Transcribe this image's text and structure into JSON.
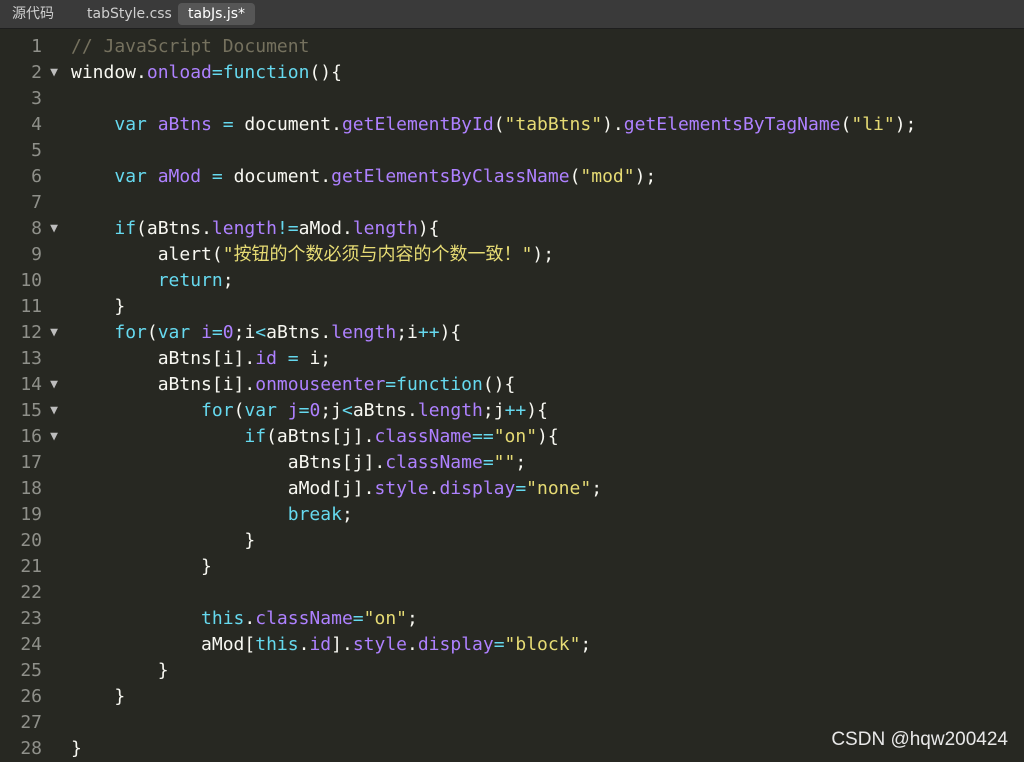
{
  "tabs": [
    {
      "label": "源代码",
      "active": false
    },
    {
      "label": "tabStyle.css",
      "active": false
    },
    {
      "label": "tabJs.js*",
      "active": true
    }
  ],
  "colors": {
    "background": "#272822",
    "comment": "#75715e",
    "keyword": "#66d9ef",
    "property": "#ae81ff",
    "string": "#e6db74",
    "number": "#ae81ff",
    "text": "#f8f8f2"
  },
  "fold_icon": "triangle-down-icon",
  "editor": {
    "lines": [
      {
        "num": "1",
        "fold": false,
        "tokens": [
          [
            "comment",
            "// JavaScript Document"
          ]
        ]
      },
      {
        "num": "2",
        "fold": true,
        "tokens": [
          [
            "plain",
            "window."
          ],
          [
            "property",
            "onload"
          ],
          [
            "keyword",
            "=function"
          ],
          [
            "plain",
            "(){"
          ]
        ]
      },
      {
        "num": "3",
        "fold": false,
        "tokens": []
      },
      {
        "num": "4",
        "fold": false,
        "tokens": [
          [
            "plain",
            "    "
          ],
          [
            "keyword",
            "var"
          ],
          [
            "plain",
            " "
          ],
          [
            "property",
            "aBtns"
          ],
          [
            "plain",
            " "
          ],
          [
            "keyword",
            "="
          ],
          [
            "plain",
            " document."
          ],
          [
            "property",
            "getElementById"
          ],
          [
            "plain",
            "("
          ],
          [
            "string",
            "\"tabBtns\""
          ],
          [
            "plain",
            ")."
          ],
          [
            "property",
            "getElementsByTagName"
          ],
          [
            "plain",
            "("
          ],
          [
            "string",
            "\"li\""
          ],
          [
            "plain",
            ");"
          ]
        ]
      },
      {
        "num": "5",
        "fold": false,
        "tokens": []
      },
      {
        "num": "6",
        "fold": false,
        "tokens": [
          [
            "plain",
            "    "
          ],
          [
            "keyword",
            "var"
          ],
          [
            "plain",
            " "
          ],
          [
            "property",
            "aMod"
          ],
          [
            "plain",
            " "
          ],
          [
            "keyword",
            "="
          ],
          [
            "plain",
            " document."
          ],
          [
            "property",
            "getElementsByClassName"
          ],
          [
            "plain",
            "("
          ],
          [
            "string",
            "\"mod\""
          ],
          [
            "plain",
            ");"
          ]
        ]
      },
      {
        "num": "7",
        "fold": false,
        "tokens": []
      },
      {
        "num": "8",
        "fold": true,
        "tokens": [
          [
            "plain",
            "    "
          ],
          [
            "keyword",
            "if"
          ],
          [
            "plain",
            "(aBtns."
          ],
          [
            "property",
            "length"
          ],
          [
            "keyword",
            "!="
          ],
          [
            "plain",
            "aMod."
          ],
          [
            "property",
            "length"
          ],
          [
            "plain",
            "){"
          ]
        ]
      },
      {
        "num": "9",
        "fold": false,
        "tokens": [
          [
            "plain",
            "        alert("
          ],
          [
            "string",
            "\""
          ],
          [
            "cjk",
            "按钮的个数必须与内容的个数一致！"
          ],
          [
            "string",
            "\""
          ],
          [
            "plain",
            ");"
          ]
        ]
      },
      {
        "num": "10",
        "fold": false,
        "tokens": [
          [
            "plain",
            "        "
          ],
          [
            "keyword",
            "return"
          ],
          [
            "plain",
            ";"
          ]
        ]
      },
      {
        "num": "11",
        "fold": false,
        "tokens": [
          [
            "plain",
            "    }"
          ]
        ]
      },
      {
        "num": "12",
        "fold": true,
        "tokens": [
          [
            "plain",
            "    "
          ],
          [
            "keyword",
            "for"
          ],
          [
            "plain",
            "("
          ],
          [
            "keyword",
            "var"
          ],
          [
            "plain",
            " "
          ],
          [
            "property",
            "i"
          ],
          [
            "keyword",
            "="
          ],
          [
            "number",
            "0"
          ],
          [
            "plain",
            ";i"
          ],
          [
            "keyword",
            "<"
          ],
          [
            "plain",
            "aBtns."
          ],
          [
            "property",
            "length"
          ],
          [
            "plain",
            ";i"
          ],
          [
            "keyword",
            "++"
          ],
          [
            "plain",
            "){"
          ]
        ]
      },
      {
        "num": "13",
        "fold": false,
        "tokens": [
          [
            "plain",
            "        aBtns[i]."
          ],
          [
            "property",
            "id"
          ],
          [
            "plain",
            " "
          ],
          [
            "keyword",
            "="
          ],
          [
            "plain",
            " i;"
          ]
        ]
      },
      {
        "num": "14",
        "fold": true,
        "tokens": [
          [
            "plain",
            "        aBtns[i]."
          ],
          [
            "property",
            "onmouseenter"
          ],
          [
            "keyword",
            "=function"
          ],
          [
            "plain",
            "(){"
          ]
        ]
      },
      {
        "num": "15",
        "fold": true,
        "tokens": [
          [
            "plain",
            "            "
          ],
          [
            "keyword",
            "for"
          ],
          [
            "plain",
            "("
          ],
          [
            "keyword",
            "var"
          ],
          [
            "plain",
            " "
          ],
          [
            "property",
            "j"
          ],
          [
            "keyword",
            "="
          ],
          [
            "number",
            "0"
          ],
          [
            "plain",
            ";j"
          ],
          [
            "keyword",
            "<"
          ],
          [
            "plain",
            "aBtns."
          ],
          [
            "property",
            "length"
          ],
          [
            "plain",
            ";j"
          ],
          [
            "keyword",
            "++"
          ],
          [
            "plain",
            "){"
          ]
        ]
      },
      {
        "num": "16",
        "fold": true,
        "tokens": [
          [
            "plain",
            "                "
          ],
          [
            "keyword",
            "if"
          ],
          [
            "plain",
            "(aBtns[j]."
          ],
          [
            "property",
            "className"
          ],
          [
            "keyword",
            "=="
          ],
          [
            "string",
            "\"on\""
          ],
          [
            "plain",
            "){"
          ]
        ]
      },
      {
        "num": "17",
        "fold": false,
        "tokens": [
          [
            "plain",
            "                    aBtns[j]."
          ],
          [
            "property",
            "className"
          ],
          [
            "keyword",
            "="
          ],
          [
            "string",
            "\"\""
          ],
          [
            "plain",
            ";"
          ]
        ]
      },
      {
        "num": "18",
        "fold": false,
        "tokens": [
          [
            "plain",
            "                    aMod[j]."
          ],
          [
            "property",
            "style"
          ],
          [
            "plain",
            "."
          ],
          [
            "property",
            "display"
          ],
          [
            "keyword",
            "="
          ],
          [
            "string",
            "\"none\""
          ],
          [
            "plain",
            ";"
          ]
        ]
      },
      {
        "num": "19",
        "fold": false,
        "tokens": [
          [
            "plain",
            "                    "
          ],
          [
            "keyword",
            "break"
          ],
          [
            "plain",
            ";"
          ]
        ]
      },
      {
        "num": "20",
        "fold": false,
        "tokens": [
          [
            "plain",
            "                }"
          ]
        ]
      },
      {
        "num": "21",
        "fold": false,
        "tokens": [
          [
            "plain",
            "            }"
          ]
        ]
      },
      {
        "num": "22",
        "fold": false,
        "tokens": []
      },
      {
        "num": "23",
        "fold": false,
        "tokens": [
          [
            "plain",
            "            "
          ],
          [
            "keyword",
            "this"
          ],
          [
            "plain",
            "."
          ],
          [
            "property",
            "className"
          ],
          [
            "keyword",
            "="
          ],
          [
            "string",
            "\"on\""
          ],
          [
            "plain",
            ";"
          ]
        ]
      },
      {
        "num": "24",
        "fold": false,
        "tokens": [
          [
            "plain",
            "            aMod["
          ],
          [
            "keyword",
            "this"
          ],
          [
            "plain",
            "."
          ],
          [
            "property",
            "id"
          ],
          [
            "plain",
            "]."
          ],
          [
            "property",
            "style"
          ],
          [
            "plain",
            "."
          ],
          [
            "property",
            "display"
          ],
          [
            "keyword",
            "="
          ],
          [
            "string",
            "\"block\""
          ],
          [
            "plain",
            ";"
          ]
        ]
      },
      {
        "num": "25",
        "fold": false,
        "tokens": [
          [
            "plain",
            "        }"
          ]
        ]
      },
      {
        "num": "26",
        "fold": false,
        "tokens": [
          [
            "plain",
            "    }"
          ]
        ]
      },
      {
        "num": "27",
        "fold": false,
        "tokens": []
      },
      {
        "num": "28",
        "fold": false,
        "tokens": [
          [
            "plain",
            "}"
          ]
        ]
      }
    ]
  },
  "watermark": "CSDN @hqw200424"
}
